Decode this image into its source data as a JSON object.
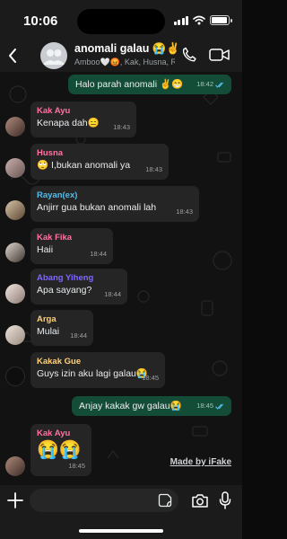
{
  "status_bar": {
    "time": "10:06"
  },
  "header": {
    "title": "anomali galau 😭✌",
    "subtitle": "Amboo🤍😡, Kak, Husna, Rayan(ex), Kak Fika, Abang Yiheng, Arga, Kakak Gue"
  },
  "messages": [
    {
      "direction": "out",
      "text": "Halo parah anomali ✌😁",
      "time": "18:42",
      "read": true
    },
    {
      "direction": "in",
      "sender": "Kak Ayu",
      "sender_color": "#ff72a1",
      "text": "Kenapa dah😑",
      "time": "18:43"
    },
    {
      "direction": "in",
      "sender": "Husna",
      "sender_color": "#ff72a1",
      "text": "🙄 I,bukan anomali ya",
      "time": "18:43"
    },
    {
      "direction": "in",
      "sender": "Rayan(ex)",
      "sender_color": "#53bdeb",
      "text": "Anjirr gua bukan anomali lah",
      "time": "18:43"
    },
    {
      "direction": "in",
      "sender": "Kak Fika",
      "sender_color": "#ff72a1",
      "text": "Haii",
      "time": "18:44"
    },
    {
      "direction": "in",
      "sender": "Abang Yiheng",
      "sender_color": "#7f66ff",
      "text": "Apa sayang?",
      "time": "18:44"
    },
    {
      "direction": "in",
      "sender": "Arga",
      "sender_color": "#ffd279",
      "text": "Mulai",
      "time": "18:44"
    },
    {
      "direction": "in",
      "sender": "Kakak Gue",
      "sender_color": "#ffd279",
      "text": "Guys izin aku lagi galau😭",
      "time": "18:45"
    },
    {
      "direction": "out",
      "text": "Anjay kakak gw galau😭",
      "time": "18:45",
      "read": true
    },
    {
      "direction": "in",
      "sender": "Kak Ayu",
      "sender_color": "#ff72a1",
      "text": "😭😭",
      "time": "18:45"
    }
  ],
  "watermark": "Made by iFake",
  "colors": {
    "outgoing_bubble": "#144d37",
    "incoming_bubble": "#252525",
    "read_ticks": "#53bdeb"
  },
  "icons": [
    "back-chevron-icon",
    "phone-icon",
    "video-call-icon",
    "plus-icon",
    "sticker-icon",
    "camera-icon",
    "microphone-icon"
  ]
}
